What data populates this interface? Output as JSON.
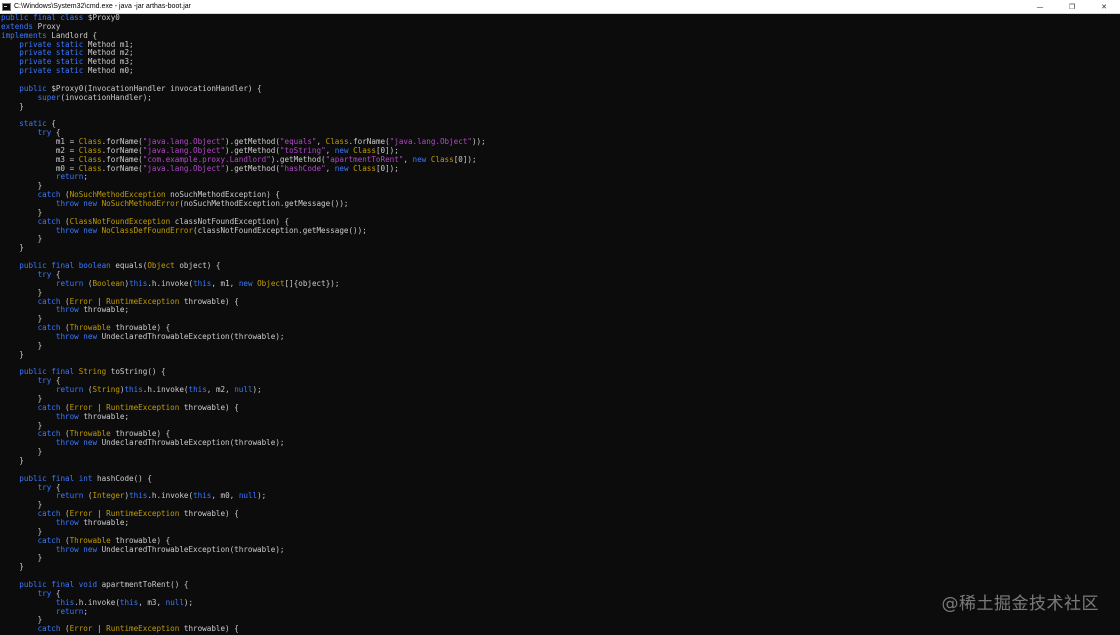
{
  "window": {
    "title": "C:\\Windows\\System32\\cmd.exe - java  -jar arthas-boot.jar",
    "controls": {
      "minimize": "—",
      "maximize": "❐",
      "close": "✕"
    }
  },
  "console": {
    "colors": {
      "background": "#0c0c0c",
      "text": "#cccccc",
      "keyword": "#3b78ff",
      "string": "#b148c6",
      "type": "#c19c00"
    },
    "lines": [
      [
        [
          "k",
          "public final class "
        ],
        [
          "t",
          "$Proxy0"
        ]
      ],
      [
        [
          "k",
          "extends "
        ],
        [
          "t",
          "Proxy"
        ]
      ],
      [
        [
          "k",
          "implements "
        ],
        [
          "t",
          "Landlord {"
        ]
      ],
      [
        [
          "t",
          "    "
        ],
        [
          "k",
          "private static "
        ],
        [
          "t",
          "Method m1;"
        ]
      ],
      [
        [
          "t",
          "    "
        ],
        [
          "k",
          "private static "
        ],
        [
          "t",
          "Method m2;"
        ]
      ],
      [
        [
          "t",
          "    "
        ],
        [
          "k",
          "private static "
        ],
        [
          "t",
          "Method m3;"
        ]
      ],
      [
        [
          "t",
          "    "
        ],
        [
          "k",
          "private static "
        ],
        [
          "t",
          "Method m0;"
        ]
      ],
      [],
      [
        [
          "t",
          "    "
        ],
        [
          "k",
          "public "
        ],
        [
          "t",
          "$Proxy0(InvocationHandler invocationHandler) {"
        ]
      ],
      [
        [
          "t",
          "        "
        ],
        [
          "k",
          "super"
        ],
        [
          "t",
          "(invocationHandler);"
        ]
      ],
      [
        [
          "t",
          "    }"
        ]
      ],
      [],
      [
        [
          "t",
          "    "
        ],
        [
          "k",
          "static "
        ],
        [
          "t",
          "{"
        ]
      ],
      [
        [
          "t",
          "        "
        ],
        [
          "k",
          "try "
        ],
        [
          "t",
          "{"
        ]
      ],
      [
        [
          "t",
          "            m1 = "
        ],
        [
          "o",
          "Class"
        ],
        [
          "t",
          ".forName("
        ],
        [
          "s",
          "\"java.lang.Object\""
        ],
        [
          "t",
          ").getMethod("
        ],
        [
          "s",
          "\"equals\""
        ],
        [
          "t",
          ", "
        ],
        [
          "o",
          "Class"
        ],
        [
          "t",
          ".forName("
        ],
        [
          "s",
          "\"java.lang.Object\""
        ],
        [
          "t",
          "));"
        ]
      ],
      [
        [
          "t",
          "            m2 = "
        ],
        [
          "o",
          "Class"
        ],
        [
          "t",
          ".forName("
        ],
        [
          "s",
          "\"java.lang.Object\""
        ],
        [
          "t",
          ").getMethod("
        ],
        [
          "s",
          "\"toString\""
        ],
        [
          "t",
          ", "
        ],
        [
          "k",
          "new "
        ],
        [
          "o",
          "Class"
        ],
        [
          "t",
          "[0]);"
        ]
      ],
      [
        [
          "t",
          "            m3 = "
        ],
        [
          "o",
          "Class"
        ],
        [
          "t",
          ".forName("
        ],
        [
          "s",
          "\"com.example.proxy.Landlord\""
        ],
        [
          "t",
          ").getMethod("
        ],
        [
          "s",
          "\"apartmentToRent\""
        ],
        [
          "t",
          ", "
        ],
        [
          "k",
          "new "
        ],
        [
          "o",
          "Class"
        ],
        [
          "t",
          "[0]);"
        ]
      ],
      [
        [
          "t",
          "            m0 = "
        ],
        [
          "o",
          "Class"
        ],
        [
          "t",
          ".forName("
        ],
        [
          "s",
          "\"java.lang.Object\""
        ],
        [
          "t",
          ").getMethod("
        ],
        [
          "s",
          "\"hashCode\""
        ],
        [
          "t",
          ", "
        ],
        [
          "k",
          "new "
        ],
        [
          "o",
          "Class"
        ],
        [
          "t",
          "[0]);"
        ]
      ],
      [
        [
          "t",
          "            "
        ],
        [
          "k",
          "return"
        ],
        [
          "t",
          ";"
        ]
      ],
      [
        [
          "t",
          "        }"
        ]
      ],
      [
        [
          "t",
          "        "
        ],
        [
          "k",
          "catch "
        ],
        [
          "t",
          "("
        ],
        [
          "o",
          "NoSuchMethodException"
        ],
        [
          "t",
          " noSuchMethodException) {"
        ]
      ],
      [
        [
          "t",
          "            "
        ],
        [
          "k",
          "throw new "
        ],
        [
          "o",
          "NoSuchMethodError"
        ],
        [
          "t",
          "(noSuchMethodException.getMessage());"
        ]
      ],
      [
        [
          "t",
          "        }"
        ]
      ],
      [
        [
          "t",
          "        "
        ],
        [
          "k",
          "catch "
        ],
        [
          "t",
          "("
        ],
        [
          "o",
          "ClassNotFoundException"
        ],
        [
          "t",
          " classNotFoundException) {"
        ]
      ],
      [
        [
          "t",
          "            "
        ],
        [
          "k",
          "throw new "
        ],
        [
          "o",
          "NoClassDefFoundError"
        ],
        [
          "t",
          "(classNotFoundException.getMessage());"
        ]
      ],
      [
        [
          "t",
          "        }"
        ]
      ],
      [
        [
          "t",
          "    }"
        ]
      ],
      [],
      [
        [
          "t",
          "    "
        ],
        [
          "k",
          "public final boolean "
        ],
        [
          "t",
          "equals("
        ],
        [
          "o",
          "Object"
        ],
        [
          "t",
          " object) {"
        ]
      ],
      [
        [
          "t",
          "        "
        ],
        [
          "k",
          "try "
        ],
        [
          "t",
          "{"
        ]
      ],
      [
        [
          "t",
          "            "
        ],
        [
          "k",
          "return "
        ],
        [
          "t",
          "("
        ],
        [
          "o",
          "Boolean"
        ],
        [
          "t",
          ")"
        ],
        [
          "k",
          "this"
        ],
        [
          "t",
          ".h.invoke("
        ],
        [
          "k",
          "this"
        ],
        [
          "t",
          ", m1, "
        ],
        [
          "k",
          "new "
        ],
        [
          "o",
          "Object"
        ],
        [
          "t",
          "[]{object});"
        ]
      ],
      [
        [
          "t",
          "        }"
        ]
      ],
      [
        [
          "t",
          "        "
        ],
        [
          "k",
          "catch "
        ],
        [
          "t",
          "("
        ],
        [
          "o",
          "Error"
        ],
        [
          "t",
          " | "
        ],
        [
          "o",
          "RuntimeException"
        ],
        [
          "t",
          " throwable) {"
        ]
      ],
      [
        [
          "t",
          "            "
        ],
        [
          "k",
          "throw "
        ],
        [
          "t",
          "throwable;"
        ]
      ],
      [
        [
          "t",
          "        }"
        ]
      ],
      [
        [
          "t",
          "        "
        ],
        [
          "k",
          "catch "
        ],
        [
          "t",
          "("
        ],
        [
          "o",
          "Throwable"
        ],
        [
          "t",
          " throwable) {"
        ]
      ],
      [
        [
          "t",
          "            "
        ],
        [
          "k",
          "throw new "
        ],
        [
          "t",
          "UndeclaredThrowableException(throwable);"
        ]
      ],
      [
        [
          "t",
          "        }"
        ]
      ],
      [
        [
          "t",
          "    }"
        ]
      ],
      [],
      [
        [
          "t",
          "    "
        ],
        [
          "k",
          "public final "
        ],
        [
          "o",
          "String"
        ],
        [
          "t",
          " toString() {"
        ]
      ],
      [
        [
          "t",
          "        "
        ],
        [
          "k",
          "try "
        ],
        [
          "t",
          "{"
        ]
      ],
      [
        [
          "t",
          "            "
        ],
        [
          "k",
          "return "
        ],
        [
          "t",
          "("
        ],
        [
          "o",
          "String"
        ],
        [
          "t",
          ")"
        ],
        [
          "k",
          "this"
        ],
        [
          "t",
          ".h.invoke("
        ],
        [
          "k",
          "this"
        ],
        [
          "t",
          ", m2, "
        ],
        [
          "k",
          "null"
        ],
        [
          "t",
          ");"
        ]
      ],
      [
        [
          "t",
          "        }"
        ]
      ],
      [
        [
          "t",
          "        "
        ],
        [
          "k",
          "catch "
        ],
        [
          "t",
          "("
        ],
        [
          "o",
          "Error"
        ],
        [
          "t",
          " | "
        ],
        [
          "o",
          "RuntimeException"
        ],
        [
          "t",
          " throwable) {"
        ]
      ],
      [
        [
          "t",
          "            "
        ],
        [
          "k",
          "throw "
        ],
        [
          "t",
          "throwable;"
        ]
      ],
      [
        [
          "t",
          "        }"
        ]
      ],
      [
        [
          "t",
          "        "
        ],
        [
          "k",
          "catch "
        ],
        [
          "t",
          "("
        ],
        [
          "o",
          "Throwable"
        ],
        [
          "t",
          " throwable) {"
        ]
      ],
      [
        [
          "t",
          "            "
        ],
        [
          "k",
          "throw new "
        ],
        [
          "t",
          "UndeclaredThrowableException(throwable);"
        ]
      ],
      [
        [
          "t",
          "        }"
        ]
      ],
      [
        [
          "t",
          "    }"
        ]
      ],
      [],
      [
        [
          "t",
          "    "
        ],
        [
          "k",
          "public final int "
        ],
        [
          "t",
          "hashCode() {"
        ]
      ],
      [
        [
          "t",
          "        "
        ],
        [
          "k",
          "try "
        ],
        [
          "t",
          "{"
        ]
      ],
      [
        [
          "t",
          "            "
        ],
        [
          "k",
          "return "
        ],
        [
          "t",
          "("
        ],
        [
          "o",
          "Integer"
        ],
        [
          "t",
          ")"
        ],
        [
          "k",
          "this"
        ],
        [
          "t",
          ".h.invoke("
        ],
        [
          "k",
          "this"
        ],
        [
          "t",
          ", m0, "
        ],
        [
          "k",
          "null"
        ],
        [
          "t",
          ");"
        ]
      ],
      [
        [
          "t",
          "        }"
        ]
      ],
      [
        [
          "t",
          "        "
        ],
        [
          "k",
          "catch "
        ],
        [
          "t",
          "("
        ],
        [
          "o",
          "Error"
        ],
        [
          "t",
          " | "
        ],
        [
          "o",
          "RuntimeException"
        ],
        [
          "t",
          " throwable) {"
        ]
      ],
      [
        [
          "t",
          "            "
        ],
        [
          "k",
          "throw "
        ],
        [
          "t",
          "throwable;"
        ]
      ],
      [
        [
          "t",
          "        }"
        ]
      ],
      [
        [
          "t",
          "        "
        ],
        [
          "k",
          "catch "
        ],
        [
          "t",
          "("
        ],
        [
          "o",
          "Throwable"
        ],
        [
          "t",
          " throwable) {"
        ]
      ],
      [
        [
          "t",
          "            "
        ],
        [
          "k",
          "throw new "
        ],
        [
          "t",
          "UndeclaredThrowableException(throwable);"
        ]
      ],
      [
        [
          "t",
          "        }"
        ]
      ],
      [
        [
          "t",
          "    }"
        ]
      ],
      [],
      [
        [
          "t",
          "    "
        ],
        [
          "k",
          "public final void "
        ],
        [
          "t",
          "apartmentToRent() {"
        ]
      ],
      [
        [
          "t",
          "        "
        ],
        [
          "k",
          "try "
        ],
        [
          "t",
          "{"
        ]
      ],
      [
        [
          "t",
          "            "
        ],
        [
          "k",
          "this"
        ],
        [
          "t",
          ".h.invoke("
        ],
        [
          "k",
          "this"
        ],
        [
          "t",
          ", m3, "
        ],
        [
          "k",
          "null"
        ],
        [
          "t",
          ");"
        ]
      ],
      [
        [
          "t",
          "            "
        ],
        [
          "k",
          "return"
        ],
        [
          "t",
          ";"
        ]
      ],
      [
        [
          "t",
          "        }"
        ]
      ],
      [
        [
          "t",
          "        "
        ],
        [
          "k",
          "catch "
        ],
        [
          "t",
          "("
        ],
        [
          "o",
          "Error"
        ],
        [
          "t",
          " | "
        ],
        [
          "o",
          "RuntimeException"
        ],
        [
          "t",
          " throwable) {"
        ]
      ]
    ]
  },
  "watermark": "@稀土掘金技术社区"
}
